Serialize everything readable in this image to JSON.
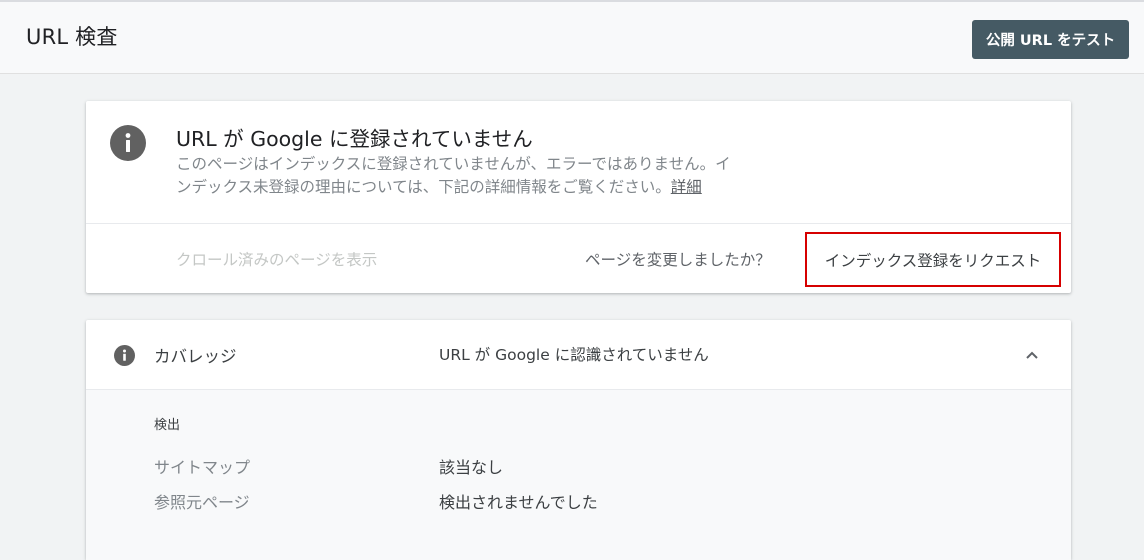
{
  "header": {
    "title": "URL 検査",
    "test_button_label": "公開 URL をテスト"
  },
  "status_card": {
    "title": "URL が Google に登録されていません",
    "description_line1": "このページはインデックスに登録されていませんが、エラーではありません。イ",
    "description_line2": "ンデックス未登録の理由については、下記の詳細情報をご覧ください。",
    "detail_link": "詳細",
    "view_crawled_label": "クロール済みのページを表示",
    "changed_question": "ページを変更しましたか？",
    "request_index_label": "インデックス登録をリクエスト",
    "highlight_color": "#d60000"
  },
  "coverage": {
    "label": "カバレッジ",
    "status": "URL が Google に認識されていません",
    "section_label": "検出",
    "rows": [
      {
        "key": "サイトマップ",
        "value": "該当なし"
      },
      {
        "key": "参照元ページ",
        "value": "検出されませんでした"
      }
    ]
  },
  "icons": {
    "status_icon": "info-icon",
    "coverage_icon": "info-icon",
    "collapse_icon": "chevron-up-icon"
  }
}
